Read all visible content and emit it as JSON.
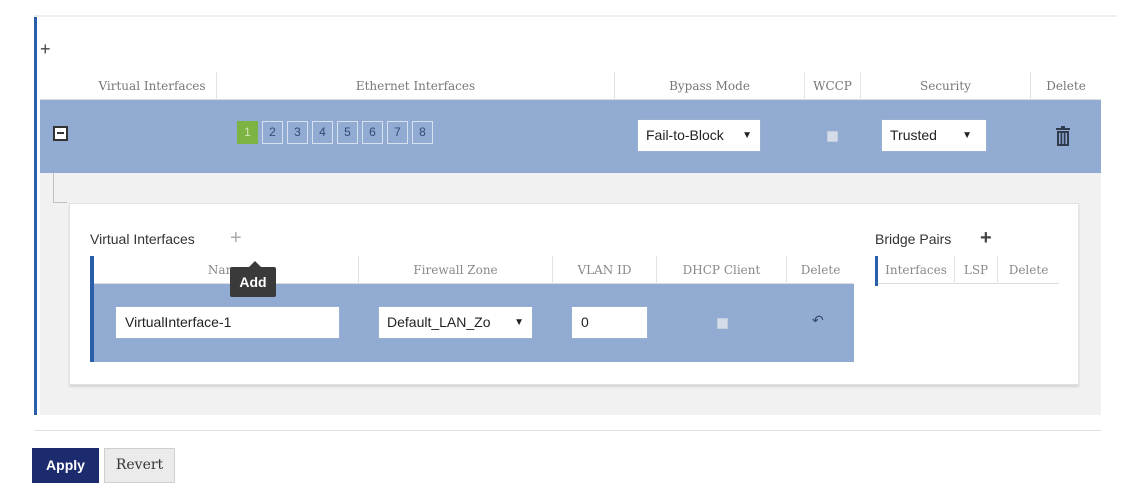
{
  "main_table": {
    "add_symbol": "+",
    "headers": [
      "Virtual Interfaces",
      "Ethernet Interfaces",
      "Bypass Mode",
      "WCCP",
      "Security",
      "Delete"
    ],
    "ethernet_ports": [
      "1",
      "2",
      "3",
      "4",
      "5",
      "6",
      "7",
      "8"
    ],
    "active_port": "1",
    "bypass_mode": "Fail-to-Block",
    "security": "Trusted",
    "dropdown_arrow": "▼"
  },
  "virtual_interfaces": {
    "label": "Virtual Interfaces",
    "add_symbol": "+",
    "tooltip": "Add",
    "headers": [
      "Name",
      "Firewall Zone",
      "VLAN ID",
      "DHCP Client",
      "Delete"
    ],
    "row": {
      "name": "VirtualInterface-1",
      "firewall_zone": "Default_LAN_Zo",
      "vlan_id": "0",
      "delete_icon": "↶"
    }
  },
  "bridge_pairs": {
    "label": "Bridge Pairs",
    "add_symbol": "+",
    "headers": [
      "Interfaces",
      "LSP",
      "Delete"
    ]
  },
  "actions": {
    "apply": "Apply",
    "revert": "Revert"
  },
  "colors": {
    "accent_blue": "#2a5ea8",
    "row_blue": "#91abd3",
    "active_port": "#7cb342",
    "apply_button": "#1c2b6e"
  }
}
